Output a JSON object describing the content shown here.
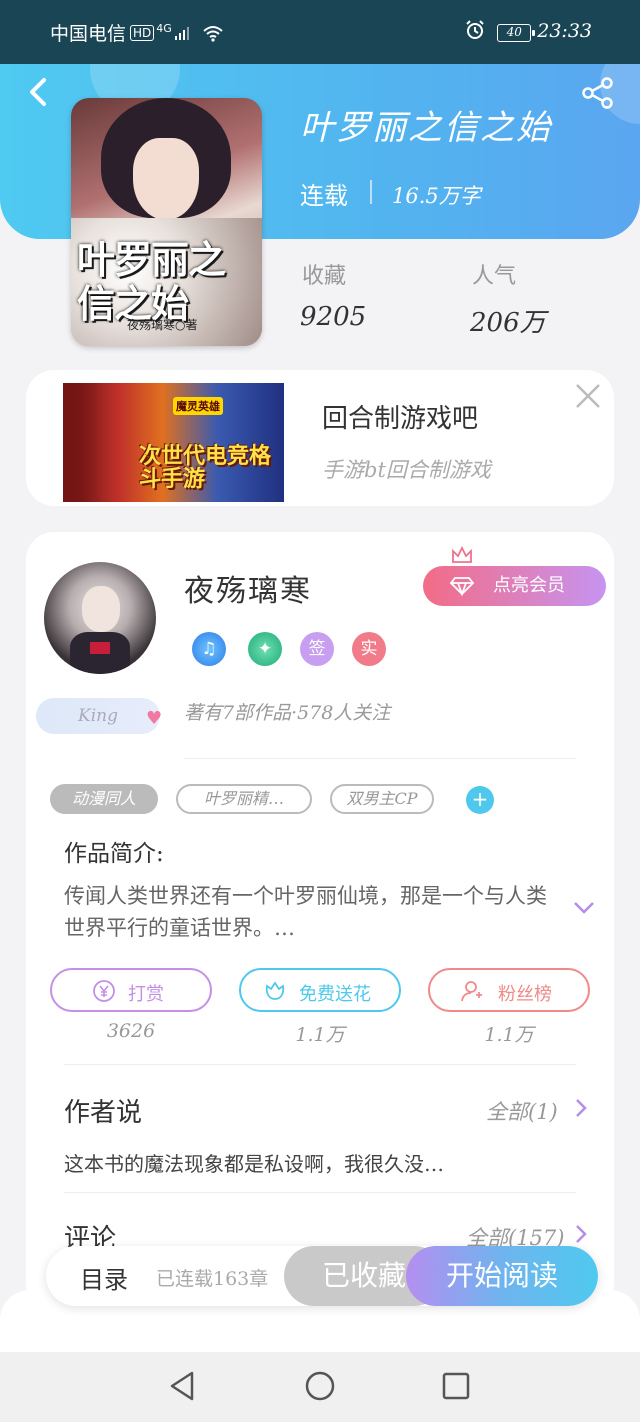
{
  "status_bar": {
    "carrier": "中国电信",
    "hd": "HD",
    "network": "4G",
    "battery": "40",
    "time": "23:33"
  },
  "book": {
    "title": "叶罗丽之信之始",
    "status": "连载",
    "word_count": "16.5万字",
    "cover_title": "叶罗丽之信之始",
    "cover_author": "夜殇璃寒○著",
    "stats": {
      "favorites_label": "收藏",
      "favorites_value": "9205",
      "popularity_label": "人气",
      "popularity_value": "206万"
    }
  },
  "ad": {
    "image_text": "次世代电竞格斗手游",
    "image_badge": "魔灵英雄",
    "title": "回合制游戏吧",
    "subtitle": "手游bt回合制游戏"
  },
  "author": {
    "name": "夜殇璃寒",
    "vip_button": "点亮会员",
    "badges": [
      "♫",
      "✦",
      "签",
      "实"
    ],
    "level_badge": "King",
    "meta": "著有7部作品·578人关注"
  },
  "tags": [
    "动漫同人",
    "叶罗丽精…",
    "双男主CP"
  ],
  "add_tag": "+",
  "intro": {
    "title": "作品简介:",
    "text": "传闻人类世界还有一个叶罗丽仙境，那是一个与人类世界平行的童话世界。…"
  },
  "actions": [
    {
      "label": "打赏",
      "count": "3626",
      "color": "#c490e6"
    },
    {
      "label": "免费送花",
      "count": "1.1万",
      "color": "#4fc8ee"
    },
    {
      "label": "粉丝榜",
      "count": "1.1万",
      "color": "#f08a8a"
    }
  ],
  "author_says": {
    "title": "作者说",
    "link": "全部(1)",
    "content": "这本书的魔法现象都是私设啊，我很久没…"
  },
  "comments": {
    "title": "评论",
    "link": "全部(157)"
  },
  "bottom_bar": {
    "toc": "目录",
    "chapters": "已连载163章",
    "collected": "已收藏",
    "read": "开始阅读"
  }
}
